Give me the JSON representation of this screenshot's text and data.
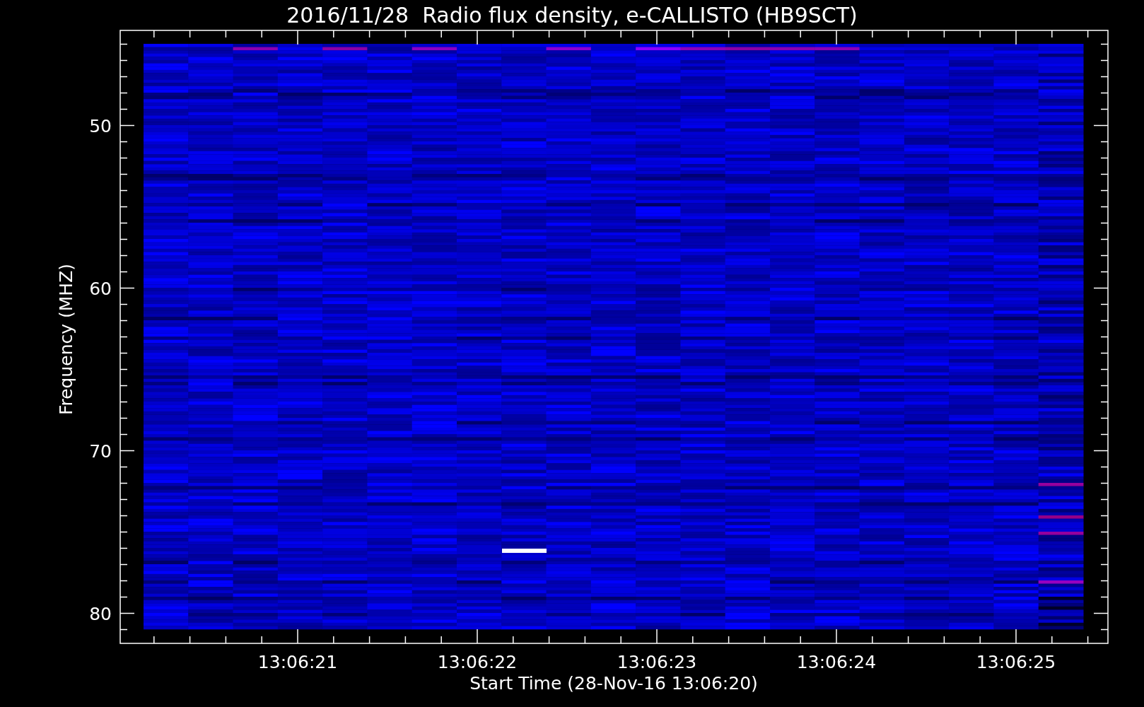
{
  "title": "2016/11/28  Radio flux density, e-CALLISTO (HB9SCT)",
  "y_axis": {
    "label": "Frequency (MHZ)",
    "ticks": [
      "50",
      "60",
      "70",
      "80"
    ]
  },
  "x_axis": {
    "label": "Start Time (28-Nov-16 13:06:20)",
    "ticks": [
      "13:06:21",
      "13:06:22",
      "13:06:23",
      "13:06:24",
      "13:06:25"
    ]
  }
}
